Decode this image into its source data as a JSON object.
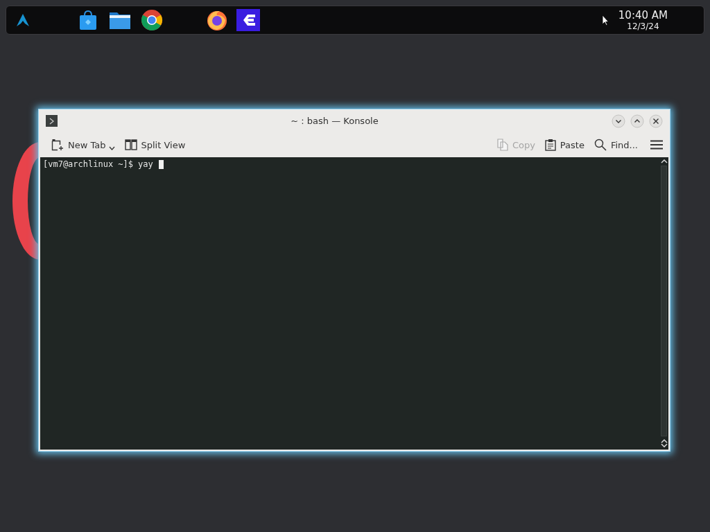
{
  "taskbar": {
    "launchers": [
      {
        "kind": "menu"
      },
      {
        "kind": "store"
      },
      {
        "kind": "files"
      },
      {
        "kind": "ring"
      },
      {
        "kind": "fox"
      },
      {
        "kind": "tile"
      }
    ],
    "clock": {
      "time": "10:40 AM",
      "date": "12/3/24"
    }
  },
  "window": {
    "title": "~ : bash — Konsole",
    "toolbar_left": [
      {
        "kind": "new-tab",
        "label": "New Tab",
        "disabled": false,
        "dropdown": true
      },
      {
        "kind": "split",
        "label": "Split View",
        "disabled": false,
        "dropdown": false
      }
    ],
    "toolbar_right": [
      {
        "kind": "copy",
        "label": "Copy",
        "disabled": true
      },
      {
        "kind": "paste",
        "label": "Paste",
        "disabled": false
      },
      {
        "kind": "find",
        "label": "Find...",
        "disabled": false
      }
    ],
    "terminal": {
      "lines": [
        {
          "prompt": "[vm7@archlinux ~]$",
          "command": "yay",
          "cursor": true
        }
      ]
    }
  }
}
